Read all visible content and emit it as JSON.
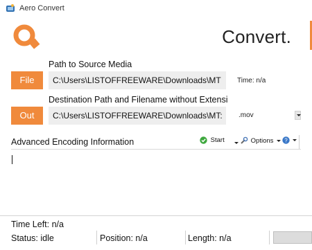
{
  "window": {
    "title": "Aero Convert"
  },
  "header": {
    "title": "Convert."
  },
  "source": {
    "label": "Path to Source Media",
    "button_label": "File",
    "path_value": "C:\\Users\\LISTOFFREEWARE\\Downloads\\MT",
    "time_text": "Time: n/a"
  },
  "destination": {
    "label": "Destination Path and Filename without Extensi",
    "button_label": "Out",
    "path_value": "C:\\Users\\LISTOFFREEWARE\\Downloads\\MT:",
    "extension_value": ".mov"
  },
  "encoding": {
    "label": "Advanced Encoding Information",
    "start_label": "Start",
    "options_label": "Options"
  },
  "status": {
    "time_left": "Time Left: n/a",
    "status": "Status: idle",
    "position": "Position: n/a",
    "length": "Length: n/a",
    "progress": 0
  },
  "colors": {
    "accent": "#f08a3c",
    "start_icon": "#3ea83e",
    "help_icon": "#3a78c8"
  }
}
